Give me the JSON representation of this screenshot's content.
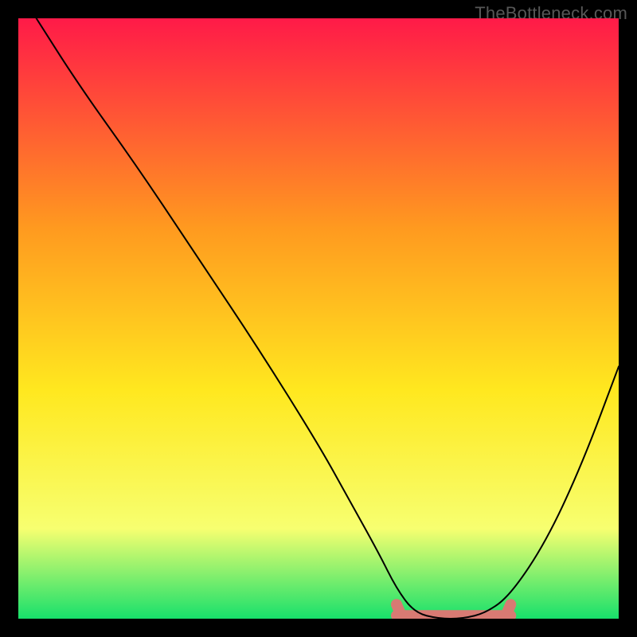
{
  "watermark": "TheBottleneck.com",
  "colors": {
    "gradient_top": "#ff1a48",
    "gradient_mid1": "#ff9a1f",
    "gradient_mid2": "#ffe81f",
    "gradient_mid3": "#f7ff70",
    "gradient_bottom": "#17e06b",
    "curve": "#000000",
    "optimal_marker": "#d87a73",
    "frame": "#000000"
  },
  "chart_data": {
    "type": "line",
    "title": "",
    "xlabel": "",
    "ylabel": "",
    "xlim": [
      0,
      100
    ],
    "ylim": [
      0,
      100
    ],
    "series": [
      {
        "name": "bottleneck-curve",
        "x": [
          3,
          10,
          20,
          30,
          40,
          50,
          55,
          60,
          63,
          66,
          70,
          74,
          78,
          82,
          88,
          94,
          100
        ],
        "y": [
          100,
          89,
          75,
          60,
          45,
          29,
          20,
          11,
          5,
          1,
          0,
          0,
          1,
          4,
          13,
          26,
          42
        ]
      }
    ],
    "optimal_range": {
      "x_start": 63,
      "x_end": 82
    }
  }
}
